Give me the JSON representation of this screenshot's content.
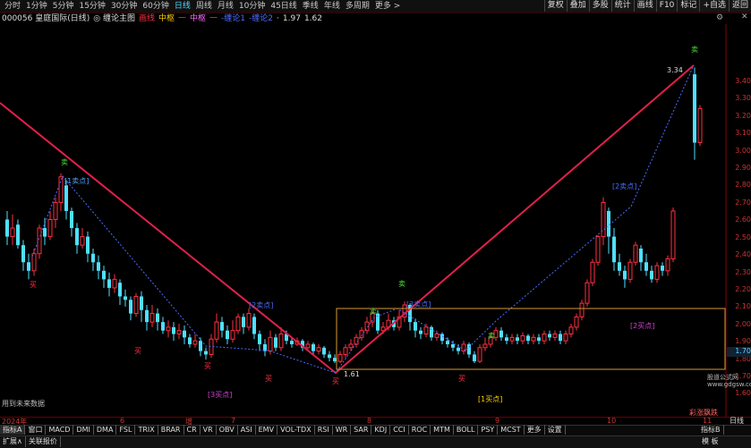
{
  "periods": [
    "分时",
    "1分钟",
    "5分钟",
    "15分钟",
    "30分钟",
    "60分钟",
    "日线",
    "周线",
    "月线",
    "10分钟",
    "45日线",
    "季线",
    "年线",
    "多周期",
    "更多 >"
  ],
  "active_period": "日线",
  "right_tools": [
    "复权",
    "叠加",
    "多股",
    "统计",
    "画线",
    "F10",
    "标记",
    "+自选",
    "返回"
  ],
  "title": {
    "code": "000056 皇庭国际(日线)",
    "indicator": "◎ 缠论主图",
    "legend": [
      "画线",
      "中枢",
      "一",
      "中枢",
      "一",
      "-缠论1",
      "-缠论2",
      "·",
      "1.97",
      "1.62"
    ]
  },
  "price_ticks": [
    "3.40",
    "3.30",
    "3.20",
    "3.10",
    "3.00",
    "2.90",
    "2.80",
    "2.70",
    "2.60",
    "2.50",
    "2.40",
    "2.30",
    "2.20",
    "2.10",
    "2.00",
    "1.90",
    "1.80",
    "1.70",
    "1.60"
  ],
  "current_price": "1.70",
  "annotations": {
    "sell1": "[1卖点]",
    "sell2a": "[2卖点]",
    "sell2b": "[2卖点]",
    "sell3": "[3卖点]",
    "buy3": "[3买点]",
    "buy1": "[1买点]",
    "buy2": "[2买点]",
    "low": "1.61",
    "high": "3.34",
    "sell_tag": "卖",
    "buy_tag": "买",
    "brand_tag": "彩涨飘跌",
    "future": "用到未来数据"
  },
  "dates": {
    "year": "2024年",
    "m6": "6",
    "m7": "7",
    "m8": "8",
    "m9": "9",
    "m10": "10",
    "m11": "11",
    "mid": "增"
  },
  "indicators": [
    "指标A",
    "窗口",
    "MACD",
    "DMI",
    "DMA",
    "FSL",
    "TRIX",
    "BRAR",
    "CR",
    "VR",
    "OBV",
    "ASI",
    "EMV",
    "VOL-TDX",
    "RSI",
    "WR",
    "SAR",
    "KDJ",
    "CCI",
    "ROC",
    "MTM",
    "BOLL",
    "PSY",
    "MCST",
    "更多",
    "设置"
  ],
  "indicator_right": [
    "指标B",
    "模 板"
  ],
  "bottom_tabs": [
    "扩展∧",
    "关联报价"
  ],
  "daily_label": "日线",
  "watermark": "股道公式网\nwww.gdgsw.com",
  "colors": {
    "up": "#ff3040",
    "down": "#4fe0ff",
    "line": "#e0204a",
    "box": "#d89a30",
    "dotted": "#4a6cff"
  }
}
